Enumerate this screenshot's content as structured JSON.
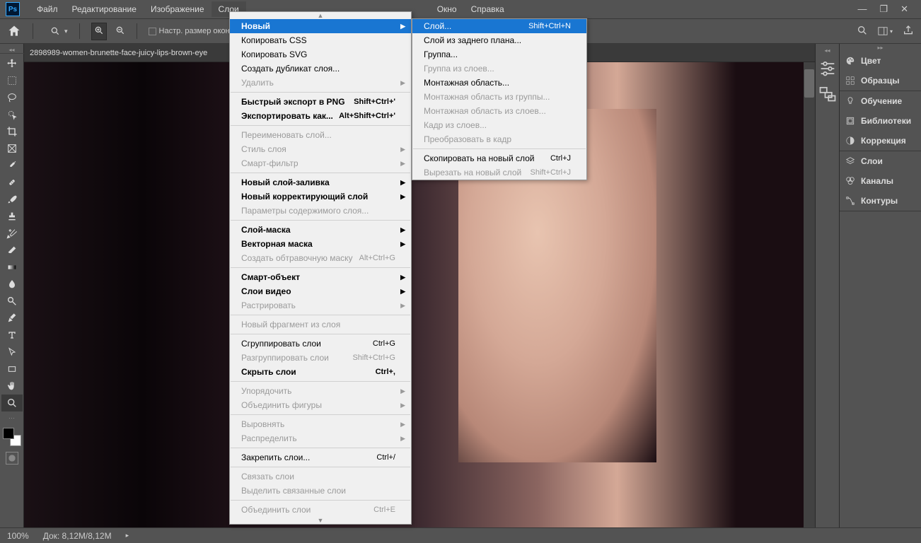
{
  "menubar": {
    "items": [
      "Файл",
      "Редактирование",
      "Изображение",
      "Слои",
      "",
      "Окно",
      "Справка"
    ],
    "openIndex": 3
  },
  "optionsbar": {
    "fitWindowLabel": "Настр. размер окон"
  },
  "documentTab": "2898989-women-brunette-face-juicy-lips-brown-eye",
  "status": {
    "zoom": "100%",
    "docinfo": "Док: 8,12M/8,12M"
  },
  "rightPanels": {
    "group1": [
      "Цвет",
      "Образцы"
    ],
    "group2": [
      "Обучение",
      "Библиотеки",
      "Коррекция"
    ],
    "group3": [
      "Слои",
      "Каналы",
      "Контуры"
    ]
  },
  "layersMenu": [
    {
      "t": "handle"
    },
    {
      "t": "item",
      "label": "Новый",
      "sub": true,
      "hl": true,
      "bold": true
    },
    {
      "t": "item",
      "label": "Копировать CSS"
    },
    {
      "t": "item",
      "label": "Копировать SVG"
    },
    {
      "t": "item",
      "label": "Создать дубликат слоя..."
    },
    {
      "t": "item",
      "label": "Удалить",
      "sub": true,
      "disabled": true
    },
    {
      "t": "sep"
    },
    {
      "t": "item",
      "label": "Быстрый экспорт в PNG",
      "shortcut": "Shift+Ctrl+'",
      "bold": true
    },
    {
      "t": "item",
      "label": "Экспортировать как...",
      "shortcut": "Alt+Shift+Ctrl+'",
      "bold": true
    },
    {
      "t": "sep"
    },
    {
      "t": "item",
      "label": "Переименовать слой...",
      "disabled": true
    },
    {
      "t": "item",
      "label": "Стиль слоя",
      "sub": true,
      "disabled": true
    },
    {
      "t": "item",
      "label": "Смарт-фильтр",
      "sub": true,
      "disabled": true
    },
    {
      "t": "sep"
    },
    {
      "t": "item",
      "label": "Новый слой-заливка",
      "sub": true,
      "bold": true
    },
    {
      "t": "item",
      "label": "Новый корректирующий слой",
      "sub": true,
      "bold": true
    },
    {
      "t": "item",
      "label": "Параметры содержимого слоя...",
      "disabled": true
    },
    {
      "t": "sep"
    },
    {
      "t": "item",
      "label": "Слой-маска",
      "sub": true,
      "bold": true
    },
    {
      "t": "item",
      "label": "Векторная маска",
      "sub": true,
      "bold": true
    },
    {
      "t": "item",
      "label": "Создать обтравочную маску",
      "shortcut": "Alt+Ctrl+G",
      "disabled": true
    },
    {
      "t": "sep"
    },
    {
      "t": "item",
      "label": "Смарт-объект",
      "sub": true,
      "bold": true
    },
    {
      "t": "item",
      "label": "Слои видео",
      "sub": true,
      "bold": true
    },
    {
      "t": "item",
      "label": "Растрировать",
      "sub": true,
      "disabled": true
    },
    {
      "t": "sep"
    },
    {
      "t": "item",
      "label": "Новый фрагмент из слоя",
      "disabled": true
    },
    {
      "t": "sep"
    },
    {
      "t": "item",
      "label": "Сгруппировать слои",
      "shortcut": "Ctrl+G"
    },
    {
      "t": "item",
      "label": "Разгруппировать слои",
      "shortcut": "Shift+Ctrl+G",
      "disabled": true
    },
    {
      "t": "item",
      "label": "Скрыть слои",
      "shortcut": "Ctrl+,",
      "bold": true
    },
    {
      "t": "sep"
    },
    {
      "t": "item",
      "label": "Упорядочить",
      "sub": true,
      "disabled": true
    },
    {
      "t": "item",
      "label": "Объединить фигуры",
      "sub": true,
      "disabled": true
    },
    {
      "t": "sep"
    },
    {
      "t": "item",
      "label": "Выровнять",
      "sub": true,
      "disabled": true
    },
    {
      "t": "item",
      "label": "Распределить",
      "sub": true,
      "disabled": true
    },
    {
      "t": "sep"
    },
    {
      "t": "item",
      "label": "Закрепить слои...",
      "shortcut": "Ctrl+/"
    },
    {
      "t": "sep"
    },
    {
      "t": "item",
      "label": "Связать слои",
      "disabled": true
    },
    {
      "t": "item",
      "label": "Выделить связанные слои",
      "disabled": true
    },
    {
      "t": "sep"
    },
    {
      "t": "item",
      "label": "Объединить слои",
      "shortcut": "Ctrl+E",
      "disabled": true
    },
    {
      "t": "handle-down"
    }
  ],
  "newSubmenu": [
    {
      "t": "item",
      "label": "Слой...",
      "shortcut": "Shift+Ctrl+N",
      "hl": true
    },
    {
      "t": "item",
      "label": "Слой из заднего плана..."
    },
    {
      "t": "item",
      "label": "Группа..."
    },
    {
      "t": "item",
      "label": "Группа из слоев...",
      "disabled": true
    },
    {
      "t": "item",
      "label": "Монтажная область..."
    },
    {
      "t": "item",
      "label": "Монтажная область из группы...",
      "disabled": true
    },
    {
      "t": "item",
      "label": "Монтажная область из слоев...",
      "disabled": true
    },
    {
      "t": "item",
      "label": "Кадр из слоев...",
      "disabled": true
    },
    {
      "t": "item",
      "label": "Преобразовать в кадр",
      "disabled": true
    },
    {
      "t": "sep"
    },
    {
      "t": "item",
      "label": "Скопировать на новый слой",
      "shortcut": "Ctrl+J"
    },
    {
      "t": "item",
      "label": "Вырезать на новый слой",
      "shortcut": "Shift+Ctrl+J",
      "disabled": true
    }
  ]
}
